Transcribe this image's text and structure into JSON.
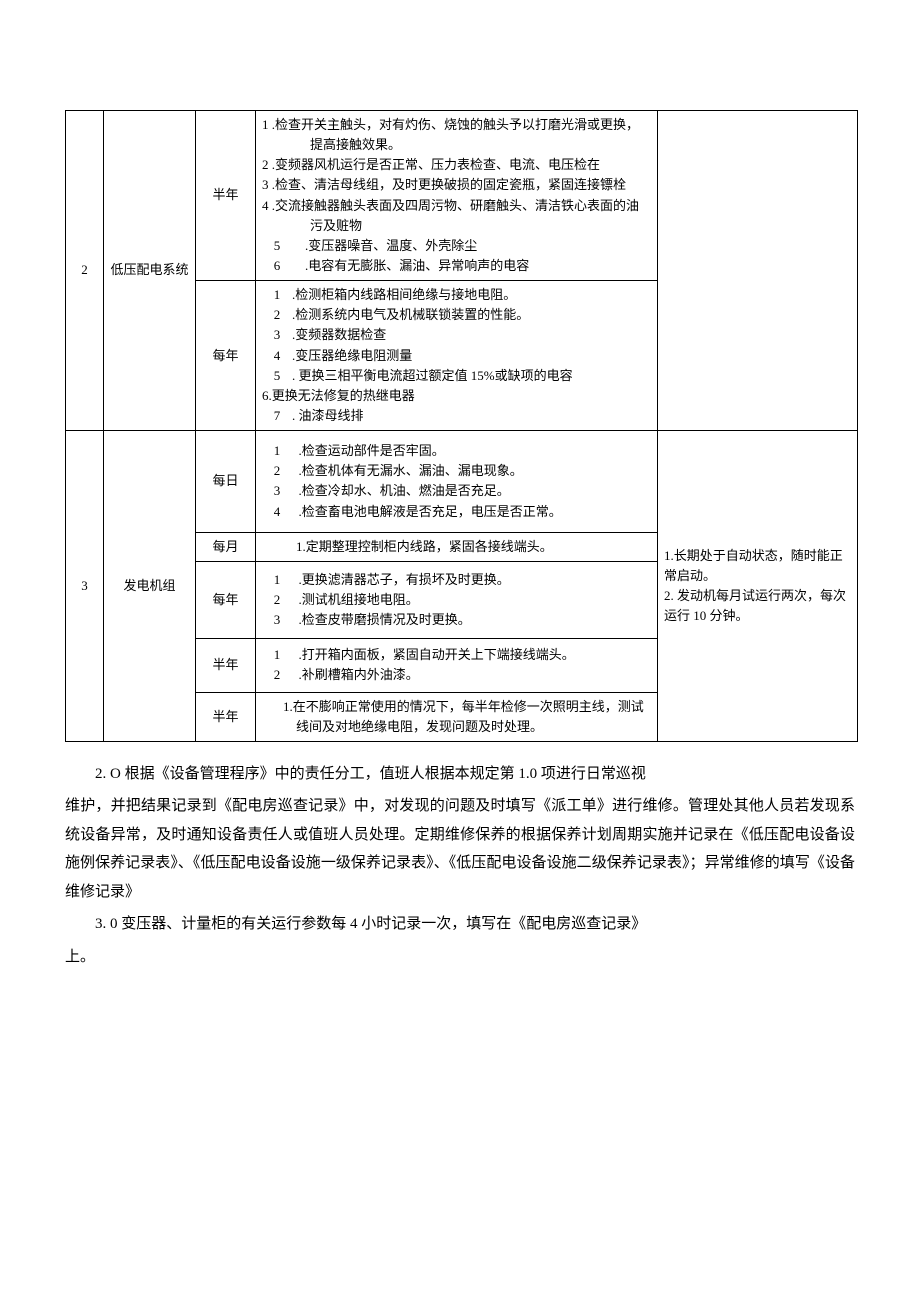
{
  "table": {
    "rows": [
      {
        "num": "2",
        "system": "低压配电系统",
        "freq1": "半年",
        "content1": {
          "l1": "1   .检查开关主触头，对有灼伤、烧蚀的触头予以打磨光滑或更换，提高接触效果。",
          "l2": "2   .变频器风机运行是否正常、压力表检查、电流、电压检在",
          "l3": "3   .检查、清洁母线组，及时更换破损的固定瓷瓶，紧固连接镖栓",
          "l4": "4   .交流接触器触头表面及四周污物、研磨触头、清洁铁心表面的油污及赃物",
          "l5a": "5",
          "l5b": ".变压器噪音、温度、外壳除尘",
          "l6a": "6",
          "l6b": ".电容有无膨胀、漏油、异常响声的电容"
        },
        "freq2": "每年",
        "content2": {
          "l1a": "1",
          "l1b": ".检测柜箱内线路相间绝缘与接地电阻。",
          "l2a": "2",
          "l2b": ".检测系统内电气及机械联锁装置的性能。",
          "l3a": "3",
          "l3b": ".变频器数据检查",
          "l4a": "4",
          "l4b": ".变压器绝缘电阻测量",
          "l5a": "5",
          "l5b": ". 更换三相平衡电流超过额定值 15%或缺项的电容",
          "l6": "6.更换无法修复的热继电器",
          "l7a": "7",
          "l7b": ". 油漆母线排"
        },
        "notes": ""
      },
      {
        "num": "3",
        "system": "发电机组",
        "freq_a": "每日",
        "content_a": {
          "l1a": "1",
          "l1b": ".检查运动部件是否牢固。",
          "l2a": "2",
          "l2b": ".检查机体有无漏水、漏油、漏电现象。",
          "l3a": "3",
          "l3b": ".检查冷却水、机油、燃油是否充足。",
          "l4a": "4",
          "l4b": ".检查畜电池电解液是否充足，电压是否正常。"
        },
        "freq_b": "每月",
        "content_b": "1.定期整理控制柜内线路，紧固各接线端头。",
        "freq_c": "每年",
        "content_c": {
          "l1a": "1",
          "l1b": ".更换滤清器芯子，有损坏及时更换。",
          "l2a": "2",
          "l2b": ".测试机组接地电阻。",
          "l3a": "3",
          "l3b": ".检查皮带磨损情况及时更换。"
        },
        "freq_d": "半年",
        "content_d": {
          "l1a": "1",
          "l1b": ".打开箱内面板，紧固自动开关上下端接线端头。",
          "l2a": "2",
          "l2b": ".补刷槽箱内外油漆。"
        },
        "freq_e": "半年",
        "content_e": "1.在不膨响正常使用的情况下，每半年检修一次照明主线，测试线间及对地绝缘电阻，发现问题及时处理。",
        "notes": "1.长期处于自动状态，随时能正常启动。\n2. 发动机每月试运行两次，每次运行 10 分钟。"
      }
    ]
  },
  "body": {
    "p1": "2.  O 根据《设备管理程序》中的责任分工，值班人根据本规定第 1.0 项进行日常巡视",
    "p2": "维护，并把结果记录到《配电房巡查记录》中，对发现的问题及时填写《派工单》进行维修。管理处其他人员若发现系统设备异常，及时通知设备责任人或值班人员处理。定期维修保养的根据保养计划周期实施并记录在《低压配电设备设施例保养记录表》、《低压配电设备设施一级保养记录表》、《低压配电设备设施二级保养记录表》；异常维修的填写《设备维修记录》",
    "p3": "3.  0 变压器、计量柜的有关运行参数每 4 小时记录一次，填写在《配电房巡查记录》",
    "p4": "上。"
  }
}
